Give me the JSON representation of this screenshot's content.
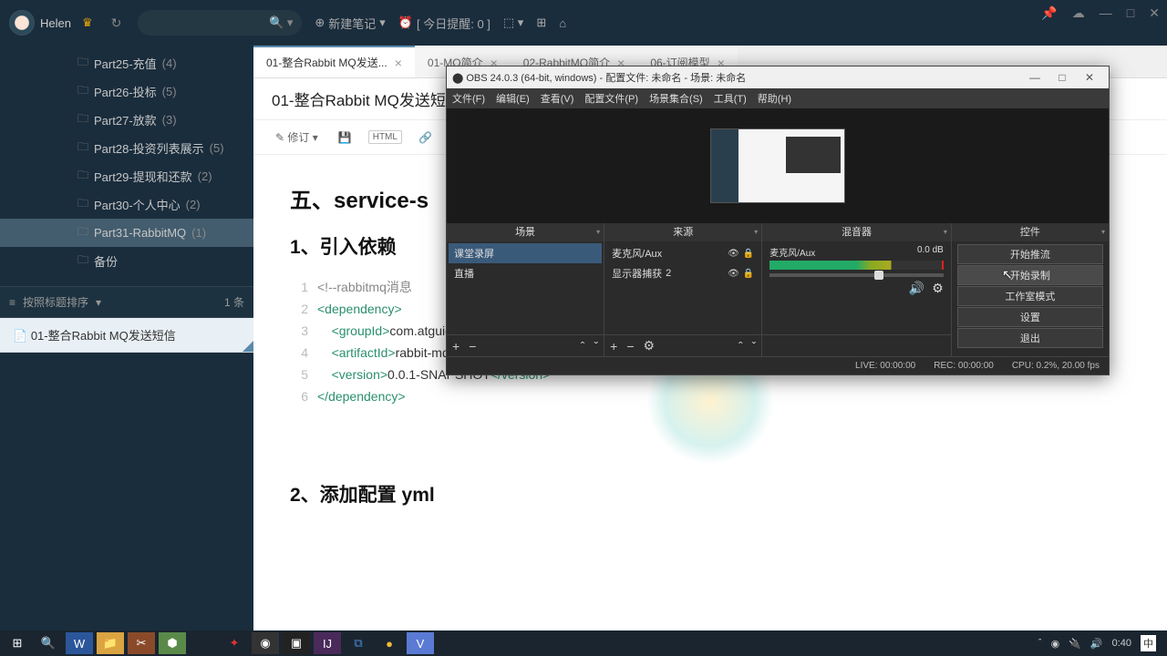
{
  "topbar": {
    "username": "Helen",
    "new_note": "新建笔记",
    "reminder": "[ 今日提醒: 0 ]"
  },
  "sidebar": {
    "items": [
      {
        "label": "Part25-充值",
        "count": "(4)"
      },
      {
        "label": "Part26-投标",
        "count": "(5)"
      },
      {
        "label": "Part27-放款",
        "count": "(3)"
      },
      {
        "label": "Part28-投资列表展示",
        "count": "(5)"
      },
      {
        "label": "Part29-提现和还款",
        "count": "(2)"
      },
      {
        "label": "Part30-个人中心",
        "count": "(2)"
      },
      {
        "label": "Part31-RabbitMQ",
        "count": "(1)"
      },
      {
        "label": "备份",
        "count": ""
      }
    ],
    "sort_label": "按照标题排序",
    "sort_count": "1 条",
    "doc": "01-整合Rabbit MQ发送短信"
  },
  "tabs": [
    {
      "label": "01-整合Rabbit MQ发送...",
      "active": true
    },
    {
      "label": "01-MQ简介",
      "active": false
    },
    {
      "label": "02-RabbitMQ简介",
      "active": false
    },
    {
      "label": "06-订阅模型",
      "active": false
    }
  ],
  "doc_title": "01-整合Rabbit MQ发送短信",
  "toolbar": {
    "revise": "修订",
    "html": "HTML"
  },
  "note": {
    "h1": "五、service-s",
    "h2": "1、引入依赖",
    "h3": "2、添加配置 yml",
    "code": [
      {
        "n": "1",
        "html": "<span class='c-comment'>&lt;!--rabbitmq消息</span>"
      },
      {
        "n": "2",
        "html": "<span class='c-tag'>&lt;dependency&gt;</span>"
      },
      {
        "n": "3",
        "html": "    <span class='c-tag'>&lt;groupId&gt;</span><span class='c-text'>com.atguigu</span><span class='c-tag'>&lt;/groupId&gt;</span>"
      },
      {
        "n": "4",
        "html": "    <span class='c-tag'>&lt;artifactId&gt;</span><span class='c-text'>rabbit-mq</span><span class='c-tag'>&lt;/artifactId&gt;</span>"
      },
      {
        "n": "5",
        "html": "    <span class='c-tag'>&lt;version&gt;</span><span class='c-text'>0.0.1-SNAPSHOT</span><span class='c-tag'>&lt;/version&gt;</span>"
      },
      {
        "n": "6",
        "html": "<span class='c-tag'>&lt;/dependency&gt;</span>"
      }
    ]
  },
  "obs": {
    "title": "OBS 24.0.3 (64-bit, windows) - 配置文件: 未命名 - 场景: 未命名",
    "menu": [
      "文件(F)",
      "编辑(E)",
      "查看(V)",
      "配置文件(P)",
      "场景集合(S)",
      "工具(T)",
      "帮助(H)"
    ],
    "panels": {
      "scenes": {
        "title": "场景",
        "items": [
          "课堂录屏",
          "直播"
        ]
      },
      "sources": {
        "title": "来源",
        "items": [
          {
            "label": "麦克风/Aux",
            "badge": ""
          },
          {
            "label": "显示器捕获",
            "badge": "2"
          }
        ]
      },
      "mixer": {
        "title": "混音器",
        "label": "麦克风/Aux",
        "db": "0.0 dB"
      },
      "controls": {
        "title": "控件",
        "buttons": [
          "开始推流",
          "开始录制",
          "工作室模式",
          "设置",
          "退出"
        ]
      }
    },
    "status": {
      "live": "LIVE: 00:00:00",
      "rec": "REC: 00:00:00",
      "cpu": "CPU: 0.2%, 20.00 fps"
    }
  },
  "sys": {
    "time": "0:40",
    "ime": "中"
  }
}
